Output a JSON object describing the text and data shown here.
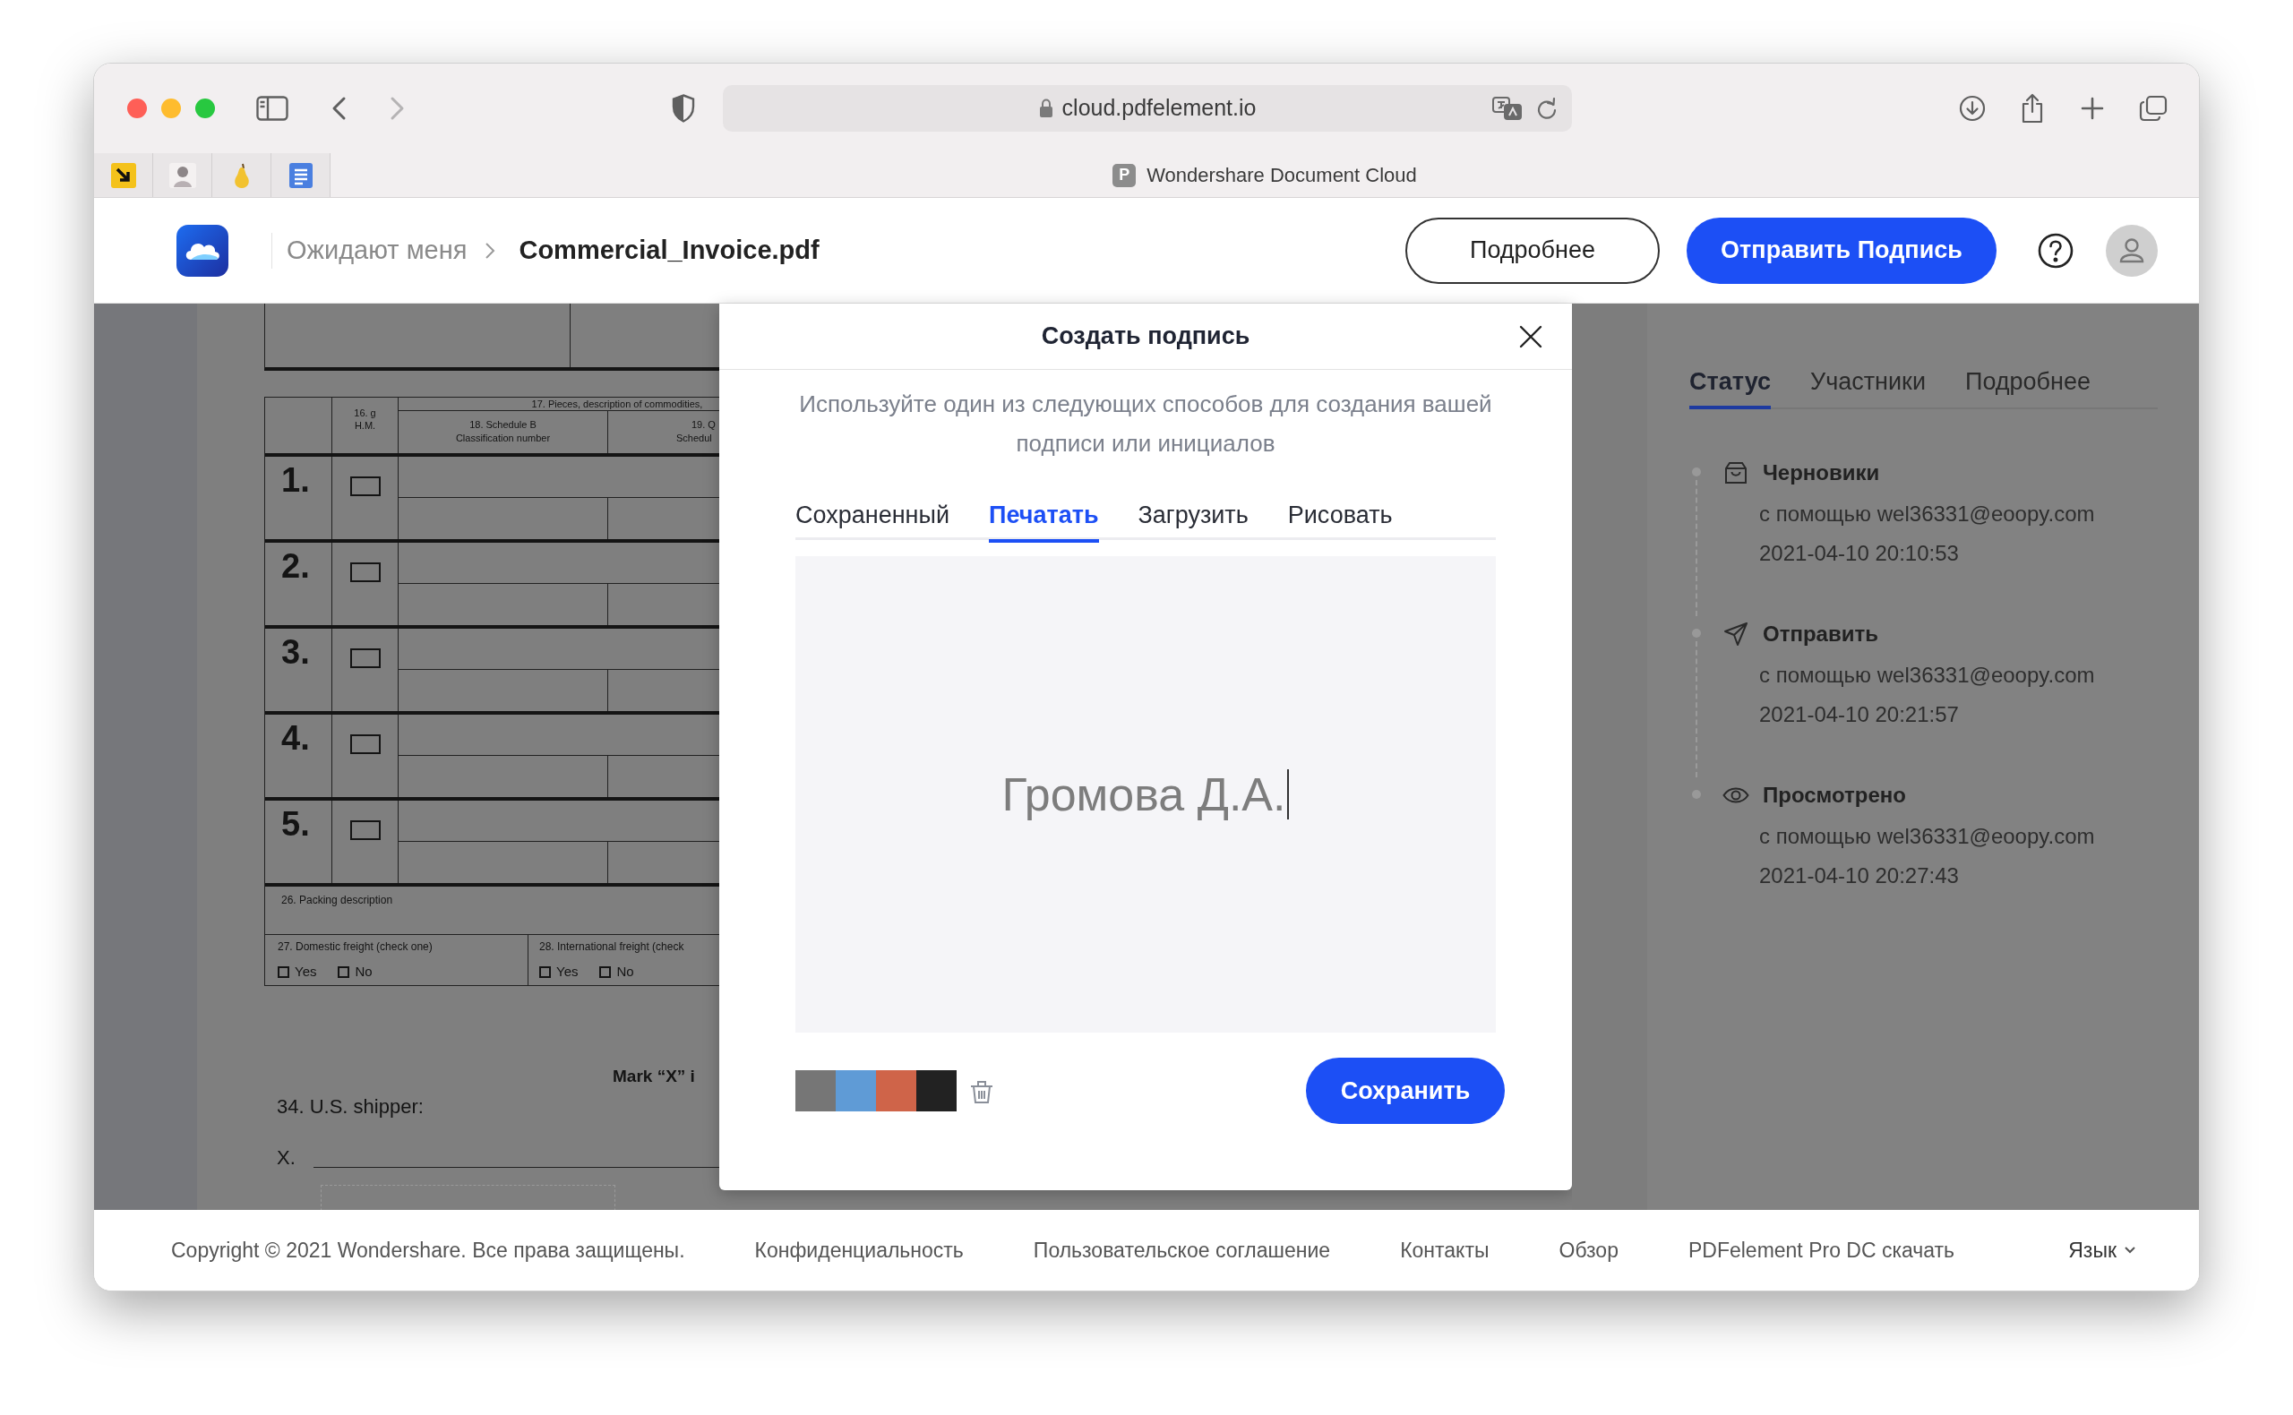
{
  "browser": {
    "url": "cloud.pdfelement.io",
    "tab_favicon": "P",
    "tab_title": "Wondershare Document Cloud"
  },
  "header": {
    "breadcrumb": "Ожидают меня",
    "file_name": "Commercial_Invoice.pdf",
    "buttons": [
      {
        "label": "Подробнее",
        "kind": "outline"
      },
      {
        "label": "Отправить Подпись",
        "kind": "primary"
      }
    ]
  },
  "document": {
    "col_16": [
      "16. g",
      "H.M."
    ],
    "col_17": "17. Pieces, description of commodities,",
    "col_18": [
      "18. Schedule B",
      "Classification number"
    ],
    "col_19": [
      "19. Q",
      "Schedul"
    ],
    "rows": [
      {
        "number": "1.",
        "checked": false
      },
      {
        "number": "2.",
        "checked": false
      },
      {
        "number": "3.",
        "checked": false
      },
      {
        "number": "4.",
        "checked": false
      },
      {
        "number": "5.",
        "checked": false
      }
    ],
    "packing": "26. Packing description",
    "freight": [
      {
        "label": "27. Domestic freight (check one)",
        "options": [
          {
            "label": "Yes",
            "checked": false
          },
          {
            "label": "No",
            "checked": false
          }
        ]
      },
      {
        "label": "28. International freight (check",
        "options": [
          {
            "label": "Yes",
            "checked": false
          },
          {
            "label": "No",
            "checked": false
          }
        ]
      }
    ],
    "mark": "Mark “X” i",
    "shipper": "34. U.S. shipper:",
    "x_label": "X."
  },
  "dialog": {
    "title": "Создать подпись",
    "description": "Используйте один из следующих способов для создания вашей подписи или инициалов",
    "tabs": [
      {
        "label": "Сохраненный",
        "selected": false
      },
      {
        "label": "Печатать",
        "selected": true
      },
      {
        "label": "Загрузить",
        "selected": false
      },
      {
        "label": "Рисовать",
        "selected": false
      }
    ],
    "signature": "Громова Д.А.",
    "colors": [
      {
        "color": "#767676"
      },
      {
        "color": "#5f9bd6"
      },
      {
        "color": "#cf6449"
      },
      {
        "color": "#222222"
      }
    ],
    "save_button": "Сохранить"
  },
  "panel": {
    "tabs": [
      {
        "label": "Статус",
        "selected": true
      },
      {
        "label": "Участники",
        "selected": false
      },
      {
        "label": "Подробнее",
        "selected": false
      }
    ],
    "timeline": [
      {
        "kind": "draft",
        "title": "Черновики",
        "by": "с помощью wel36331@eoopy.com",
        "time": "2021-04-10 20:10:53"
      },
      {
        "kind": "sent",
        "title": "Отправить",
        "by": "с помощью wel36331@eoopy.com",
        "time": "2021-04-10 20:21:57"
      },
      {
        "kind": "viewed",
        "title": "Просмотрено",
        "by": "с помощью wel36331@eoopy.com",
        "time": "2021-04-10 20:27:43"
      }
    ]
  },
  "footer": {
    "copyright": "Copyright © 2021 Wondershare. Все права защищены.",
    "links": [
      "Конфиденциальность",
      "Пользовательское соглашение",
      "Контакты",
      "Обзор",
      "PDFelement Pro DC скачать"
    ],
    "language": "Язык"
  }
}
